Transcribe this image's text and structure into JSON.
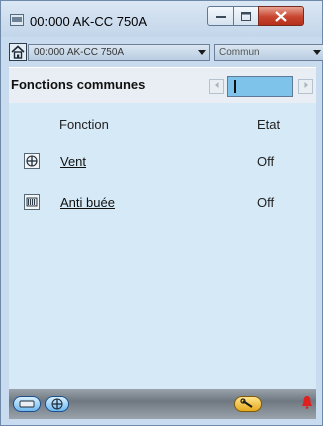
{
  "window": {
    "title": "00:000 AK-CC 750A",
    "icons": {
      "title_icon": "terminal-icon",
      "minimize": "minimize-icon",
      "maximize": "maximize-icon",
      "close": "close-icon"
    }
  },
  "toolbar": {
    "home_icon": "home-icon",
    "device_select": "00:000 AK-CC 750A",
    "group_select": "Commun"
  },
  "section": {
    "title": "Fonctions communes",
    "page_value": ""
  },
  "table": {
    "columns": [
      "Fonction",
      "Etat"
    ],
    "rows": [
      {
        "icon": "fan-icon",
        "label": "Vent",
        "state": "Off"
      },
      {
        "icon": "defrost-heater-icon",
        "label": "Anti buée",
        "state": "Off"
      }
    ]
  },
  "footer": {
    "buttons": [
      "connector-icon",
      "fan-icon",
      "wrench-icon",
      "alarm-bell-icon"
    ]
  },
  "colors": {
    "window_bg": "#c9dcef",
    "content_bg": "#d6e9f7",
    "page_field": "#7ec4ea",
    "close_button": "#c8452f",
    "alarm": "#e02020"
  }
}
